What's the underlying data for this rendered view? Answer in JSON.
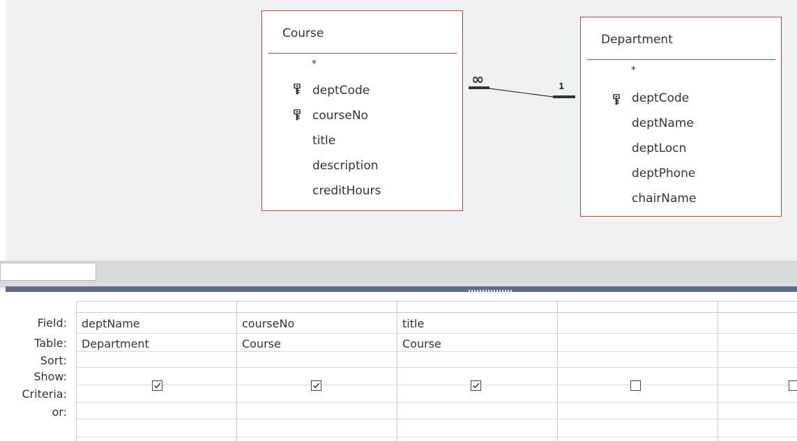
{
  "relationship_pane": {
    "tables": [
      {
        "name": "Course",
        "fields": [
          {
            "label": "*",
            "is_key": false
          },
          {
            "label": "deptCode",
            "is_key": true
          },
          {
            "label": "courseNo",
            "is_key": true
          },
          {
            "label": "title",
            "is_key": false
          },
          {
            "label": "description",
            "is_key": false
          },
          {
            "label": "creditHours",
            "is_key": false
          }
        ]
      },
      {
        "name": "Department",
        "fields": [
          {
            "label": "*",
            "is_key": false
          },
          {
            "label": "deptCode",
            "is_key": true
          },
          {
            "label": "deptName",
            "is_key": false
          },
          {
            "label": "deptLocn",
            "is_key": false
          },
          {
            "label": "deptPhone",
            "is_key": false
          },
          {
            "label": "chairName",
            "is_key": false
          }
        ]
      }
    ],
    "relationship": {
      "many_symbol": "∞",
      "one_symbol": "1"
    }
  },
  "query_grid": {
    "row_labels": [
      "Field:",
      "Table:",
      "Sort:",
      "Show:",
      "Criteria:",
      "or:"
    ],
    "columns": [
      {
        "field": "deptName",
        "table": "Department",
        "sort": "",
        "show": true,
        "criteria": "",
        "or": ""
      },
      {
        "field": "courseNo",
        "table": "Course",
        "sort": "",
        "show": true,
        "criteria": "",
        "or": ""
      },
      {
        "field": "title",
        "table": "Course",
        "sort": "",
        "show": true,
        "criteria": "",
        "or": ""
      },
      {
        "field": "",
        "table": "",
        "sort": "",
        "show": false,
        "criteria": "",
        "or": ""
      },
      {
        "field": "",
        "table": "",
        "sort": "",
        "show": false,
        "criteria": "",
        "or": ""
      }
    ]
  },
  "colors": {
    "table_border": "#b0474b",
    "splitter": "#606a8e",
    "pane_background": "#f0f1f3"
  }
}
